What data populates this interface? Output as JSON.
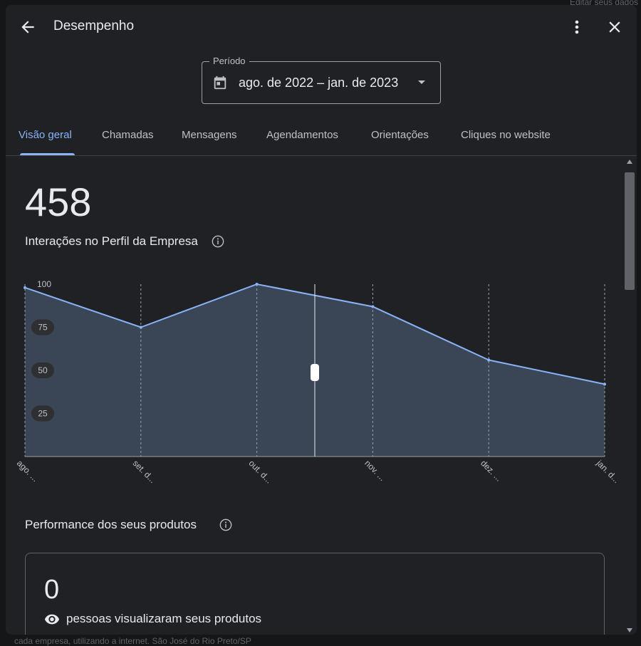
{
  "background": {
    "top_right_text": "Editar seus dados",
    "bottom_text": "cada empresa, utilizando a internet. São José do Rio Preto/SP"
  },
  "header": {
    "back_icon": "arrow-left-icon",
    "title": "Desempenho",
    "more_icon": "more-vert-icon",
    "close_icon": "close-icon"
  },
  "period": {
    "label": "Período",
    "value": "ago. de 2022 – jan. de 2023",
    "calendar_icon": "calendar-icon",
    "caret_icon": "dropdown-caret-icon"
  },
  "tabs": [
    {
      "label": "Visão geral",
      "active": true
    },
    {
      "label": "Chamadas",
      "active": false
    },
    {
      "label": "Mensagens",
      "active": false
    },
    {
      "label": "Agendamentos",
      "active": false
    },
    {
      "label": "Orientações",
      "active": false
    },
    {
      "label": "Cliques no website",
      "active": false
    }
  ],
  "summary": {
    "total": "458",
    "label": "Interações no Perfil da Empresa",
    "info_icon": "info-icon"
  },
  "chart_data": {
    "type": "area",
    "categories": [
      "ago. ...",
      "set. d...",
      "out. d...",
      "nov. ...",
      "dez. ...",
      "jan. d..."
    ],
    "values": [
      98,
      75,
      100,
      87,
      56,
      42
    ],
    "yticks": [
      100,
      75,
      50,
      25
    ],
    "ylim": [
      0,
      100
    ],
    "hover_index_position": 2.5,
    "colors": {
      "line": "#8ab4f8",
      "fill": "#3a4556",
      "grid": "#9aa0a6"
    }
  },
  "products": {
    "title": "Performance dos seus produtos",
    "count": "0",
    "views_label": "pessoas visualizaram seus produtos",
    "eye_icon": "eye-icon"
  },
  "colors": {
    "accent": "#8ab4f8",
    "surface": "#202124",
    "text": "#e8eaed"
  }
}
